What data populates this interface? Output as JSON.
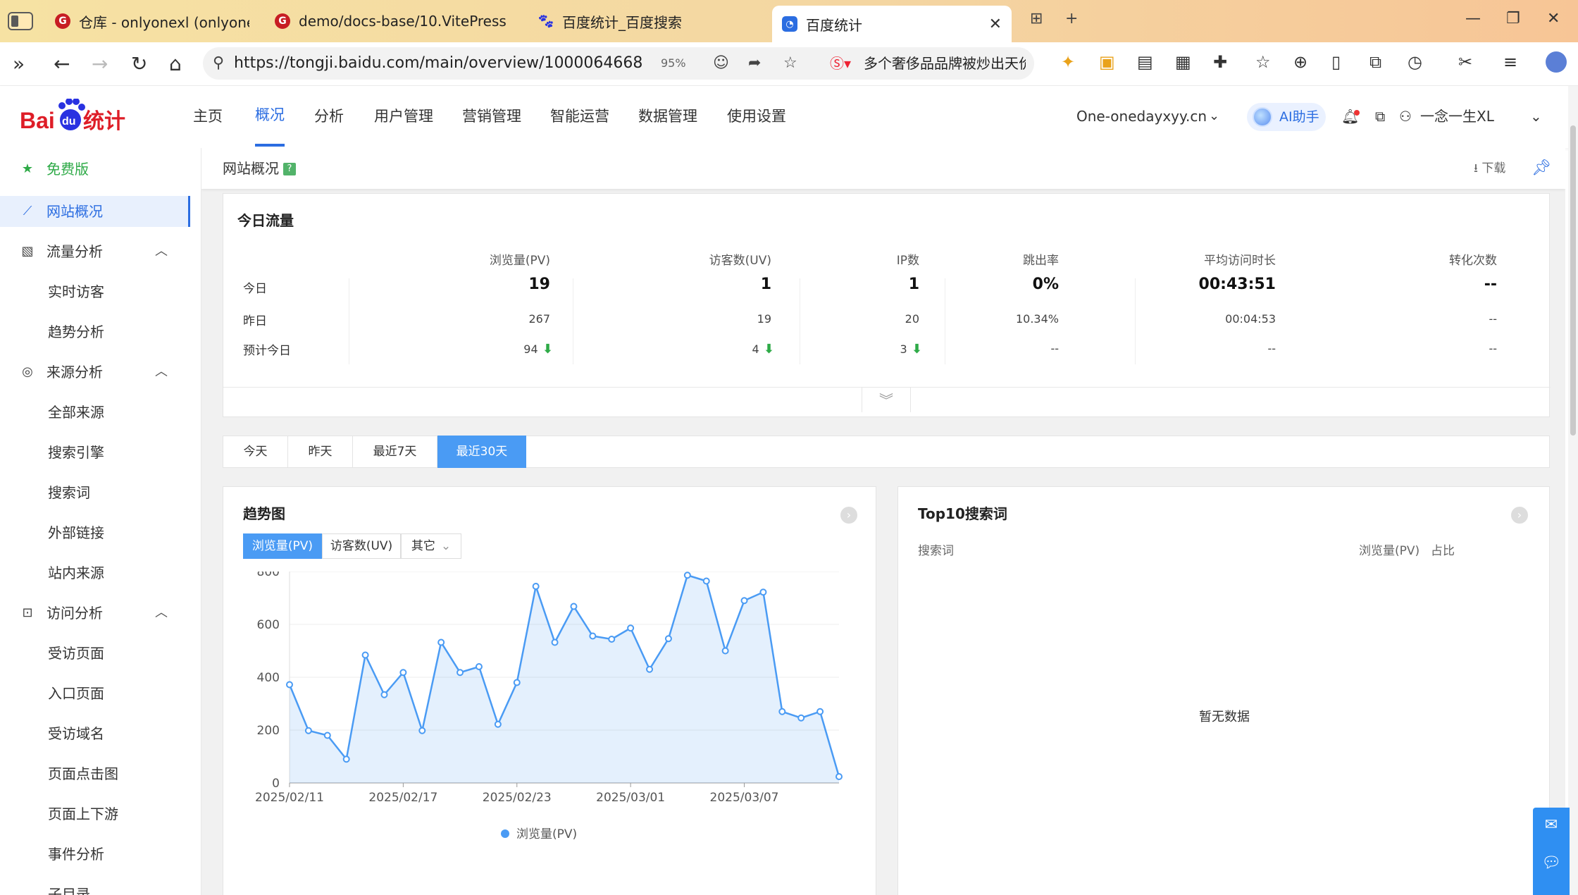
{
  "browser": {
    "tabs": [
      {
        "label": "仓库 - onlyonexl (onlyonexl) - Gi",
        "icon": "gitee-icon"
      },
      {
        "label": "demo/docs-base/10.VitePress",
        "icon": "gitee-icon"
      },
      {
        "label": "百度统计_百度搜索",
        "icon": "baidu-paw-icon"
      },
      {
        "label": "百度统计",
        "icon": "baidu-tongji-icon",
        "active": true
      }
    ],
    "url": "https://tongji.baidu.com/main/overview/1000064668",
    "zoom": "95%",
    "search_promo": "多个奢侈品品牌被炒出天价"
  },
  "site": {
    "logo_text_a": "Bai",
    "logo_text_b": "du",
    "logo_text_c": "统计",
    "nav": [
      "主页",
      "概况",
      "分析",
      "用户管理",
      "营销管理",
      "智能运营",
      "数据管理",
      "使用设置"
    ],
    "active_nav": "概况",
    "domain": "One-onedayxyy.cn",
    "ai_label": "AI助手",
    "user": "一念一生XL"
  },
  "sidebar": {
    "plan": "免费版",
    "items": [
      {
        "label": "网站概况",
        "icon": "line-chart-icon",
        "active": true
      },
      {
        "label": "流量分析",
        "icon": "image-chart-icon",
        "group": true
      },
      {
        "label": "实时访客",
        "sub": true
      },
      {
        "label": "趋势分析",
        "sub": true
      },
      {
        "label": "来源分析",
        "icon": "signal-icon",
        "group": true
      },
      {
        "label": "全部来源",
        "sub": true
      },
      {
        "label": "搜索引擎",
        "sub": true
      },
      {
        "label": "搜索词",
        "sub": true
      },
      {
        "label": "外部链接",
        "sub": true
      },
      {
        "label": "站内来源",
        "sub": true
      },
      {
        "label": "访问分析",
        "icon": "page-icon",
        "group": true
      },
      {
        "label": "受访页面",
        "sub": true
      },
      {
        "label": "入口页面",
        "sub": true
      },
      {
        "label": "受访域名",
        "sub": true
      },
      {
        "label": "页面点击图",
        "sub": true
      },
      {
        "label": "页面上下游",
        "sub": true
      },
      {
        "label": "事件分析",
        "sub": true
      },
      {
        "label": "子目录",
        "sub": true
      }
    ]
  },
  "overview": {
    "title": "网站概况",
    "download": "下载",
    "today_title": "今日流量",
    "columns": [
      "浏览量(PV)",
      "访客数(UV)",
      "IP数",
      "跳出率",
      "平均访问时长",
      "转化次数"
    ],
    "rows": [
      {
        "label": "今日",
        "values": [
          "19",
          "1",
          "1",
          "0%",
          "00:43:51",
          "--"
        ]
      },
      {
        "label": "昨日",
        "values": [
          "267",
          "19",
          "20",
          "10.34%",
          "00:04:53",
          "--"
        ]
      },
      {
        "label": "预计今日",
        "values": [
          "94",
          "4",
          "3",
          "--",
          "--",
          "--"
        ]
      }
    ]
  },
  "ranges": [
    "今天",
    "昨天",
    "最近7天",
    "最近30天"
  ],
  "active_range": "最近30天",
  "trend": {
    "title": "趋势图",
    "metric_tabs": [
      "浏览量(PV)",
      "访客数(UV)",
      "其它"
    ]
  },
  "top10": {
    "title": "Top10搜索词",
    "col_term": "搜索词",
    "col_pv": "浏览量(PV)",
    "col_share": "占比",
    "empty": "暂无数据"
  },
  "chart_data": {
    "type": "area",
    "x_ticks": [
      "2025/02/11",
      "2025/02/17",
      "2025/02/23",
      "2025/03/01",
      "2025/03/07"
    ],
    "y_ticks": [
      "0",
      "200",
      "400",
      "600",
      "800"
    ],
    "ylim": [
      0,
      800
    ],
    "x": [
      "2025/02/11",
      "2025/02/12",
      "2025/02/13",
      "2025/02/14",
      "2025/02/15",
      "2025/02/16",
      "2025/02/17",
      "2025/02/18",
      "2025/02/19",
      "2025/02/20",
      "2025/02/21",
      "2025/02/22",
      "2025/02/23",
      "2025/02/24",
      "2025/02/25",
      "2025/02/26",
      "2025/02/27",
      "2025/02/28",
      "2025/03/01",
      "2025/03/02",
      "2025/03/03",
      "2025/03/04",
      "2025/03/05",
      "2025/03/06",
      "2025/03/07",
      "2025/03/08",
      "2025/03/09",
      "2025/03/10",
      "2025/03/11",
      "2025/03/12"
    ],
    "series": [
      {
        "name": "浏览量(PV)",
        "color": "#4a9bf4",
        "values": [
          372,
          198,
          180,
          90,
          484,
          334,
          418,
          198,
          532,
          418,
          440,
          222,
          380,
          744,
          532,
          668,
          556,
          544,
          586,
          430,
          546,
          786,
          764,
          500,
          690,
          722,
          270,
          246,
          270,
          24
        ]
      }
    ],
    "legend": "bottom-center",
    "grid": true
  }
}
